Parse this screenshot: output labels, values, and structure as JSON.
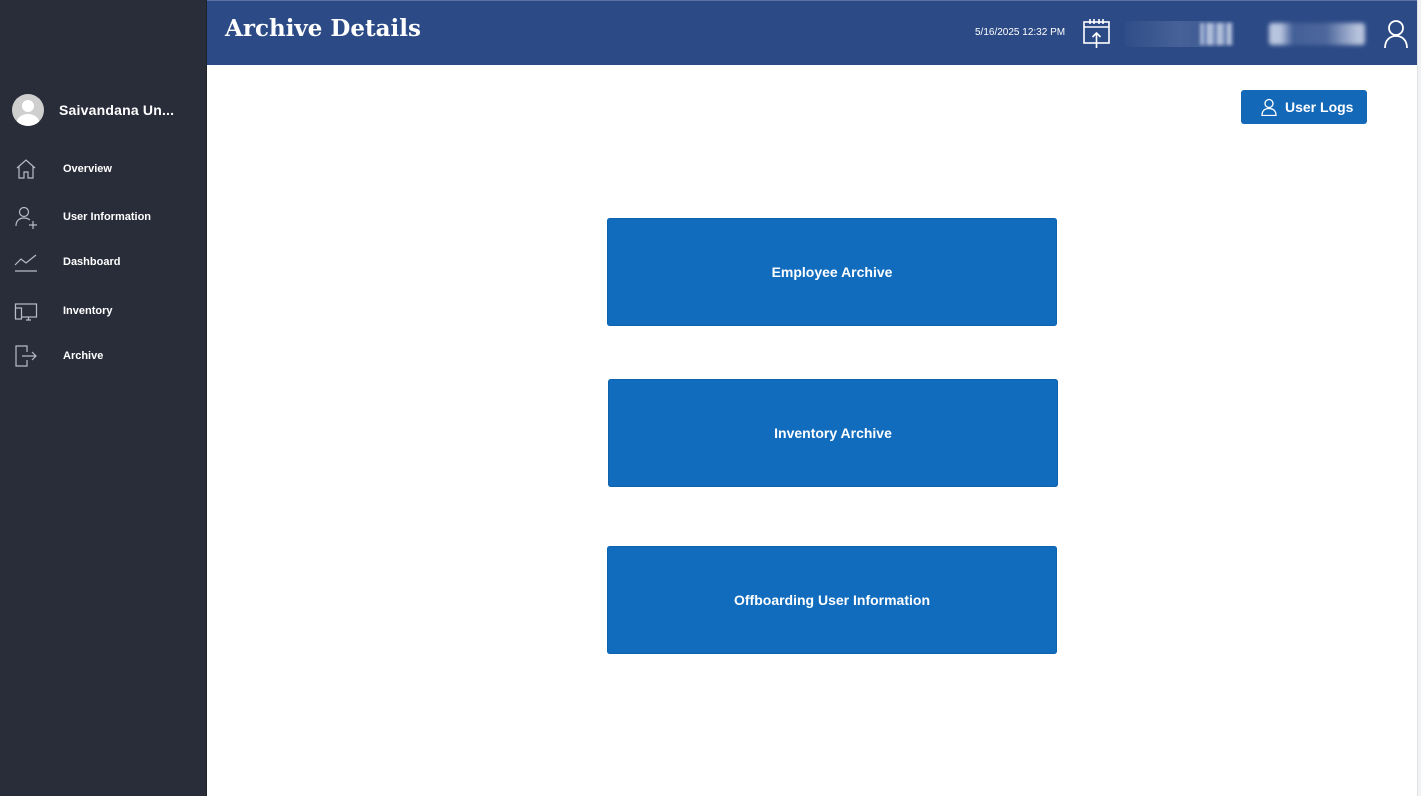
{
  "header": {
    "title": "Archive Details",
    "datetime": "5/16/2025 12:32 PM",
    "icons": [
      "calendar-upload-icon",
      "user-profile-icon"
    ]
  },
  "sidebar": {
    "user_name": "Saivandana Un...",
    "items": [
      {
        "label": "Overview",
        "icon": "home-icon"
      },
      {
        "label": "User Information",
        "icon": "add-user-icon"
      },
      {
        "label": "Dashboard",
        "icon": "trend-chart-icon"
      },
      {
        "label": "Inventory",
        "icon": "devices-icon"
      },
      {
        "label": "Archive",
        "icon": "exit-icon"
      }
    ]
  },
  "main": {
    "user_logs_label": "User Logs",
    "tiles": [
      {
        "label": "Employee Archive"
      },
      {
        "label": "Inventory Archive"
      },
      {
        "label": "Offboarding User Information"
      }
    ]
  },
  "colors": {
    "sidebar_bg": "#292d3a",
    "header_bg": "#2c4a86",
    "tile_bg": "#116cbe",
    "button_bg": "#1468b8"
  }
}
